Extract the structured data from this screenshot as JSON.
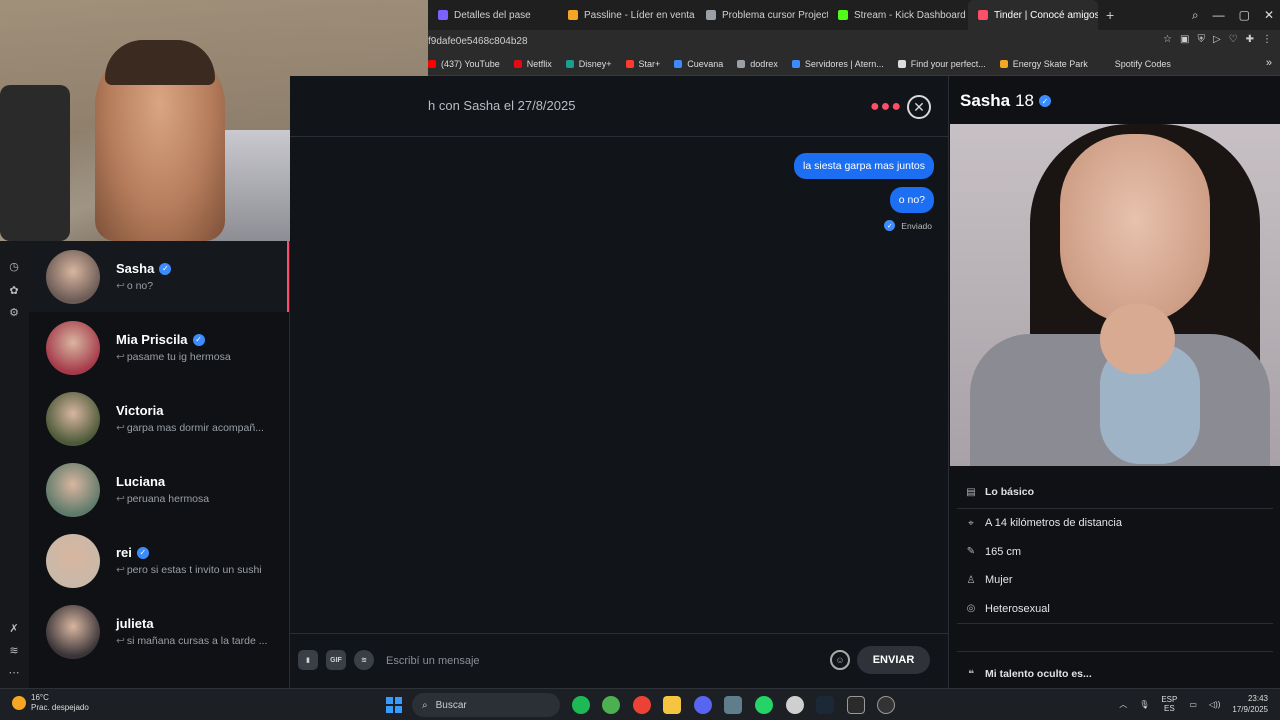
{
  "browser": {
    "tabs": [
      {
        "label": "Detalles del pase",
        "color": "#7b61ff"
      },
      {
        "label": "Passline - Líder en venta",
        "color": "#f5a623"
      },
      {
        "label": "Problema cursor Project",
        "color": "#9aa0a6"
      },
      {
        "label": "Stream - Kick Dashboard",
        "color": "#53fc18"
      },
      {
        "label": "Tinder | Conocé amigos y",
        "color": "#fd5068",
        "active": true
      }
    ],
    "new_tab": "+",
    "url": "f9dafe0e5468c804b28",
    "bookmarks": [
      {
        "label": "(437) YouTube",
        "color": "#ff0000"
      },
      {
        "label": "Netflix",
        "color": "#e50914"
      },
      {
        "label": "Disney+",
        "color": "#1a9e8f"
      },
      {
        "label": "Star+",
        "color": "#ff3b30"
      },
      {
        "label": "Cuevana",
        "color": "#3c8cff"
      },
      {
        "label": "dodrex",
        "color": "#9aa0a6"
      },
      {
        "label": "Servidores | Atern...",
        "color": "#3c8cff"
      },
      {
        "label": "Find your perfect...",
        "color": "#ddd"
      },
      {
        "label": "Energy Skate Park",
        "color": "#f5a623"
      },
      {
        "label": "Spotify Codes",
        "color": "#2b2b2b"
      }
    ]
  },
  "matches": [
    {
      "name": "Sasha",
      "verified": true,
      "preview": "o no?",
      "active": true,
      "avatar": "#6b5a55"
    },
    {
      "name": "Mia Priscila",
      "verified": true,
      "preview": "pasame tu ig hermosa",
      "active": false,
      "avatar": "#a53a4a"
    },
    {
      "name": "Victoria",
      "verified": false,
      "preview": "garpa mas dormir acompañ...",
      "active": false,
      "avatar": "#4d5a3a"
    },
    {
      "name": "Luciana",
      "verified": false,
      "preview": "peruana hermosa",
      "active": false,
      "avatar": "#5f7a6a"
    },
    {
      "name": "rei",
      "verified": true,
      "preview": "pero si estas t invito un sushi",
      "active": false,
      "avatar": "#c9b8a8"
    },
    {
      "name": "julieta",
      "verified": false,
      "preview": "si mañana cursas a la tarde ...",
      "active": false,
      "avatar": "#3a3438"
    }
  ],
  "chat": {
    "title": "h con Sasha el 27/8/2025",
    "messages": [
      "la siesta garpa mas juntos",
      "o no?"
    ],
    "status": "Enviado",
    "placeholder": "Escribí un mensaje",
    "send_label": "ENVIAR",
    "gif_label": "GIF"
  },
  "profile": {
    "name": "Sasha",
    "age": "18",
    "basics_title": "Lo básico",
    "info": [
      {
        "icon": "location-icon",
        "glyph": "⌖",
        "text": "A 14 kilómetros de distancia"
      },
      {
        "icon": "ruler-icon",
        "glyph": "✎",
        "text": "165 cm"
      },
      {
        "icon": "person-icon",
        "glyph": "♙",
        "text": "Mujer"
      },
      {
        "icon": "orientation-icon",
        "glyph": "◎",
        "text": "Heterosexual"
      }
    ],
    "talent_title": "Mi talento oculto es..."
  },
  "taskbar": {
    "weather_temp": "16°C",
    "weather_desc": "Prac. despejado",
    "search_label": "Buscar",
    "lang_top": "ESP",
    "lang_bottom": "ES",
    "time": "23:43",
    "date": "17/9/2025"
  }
}
